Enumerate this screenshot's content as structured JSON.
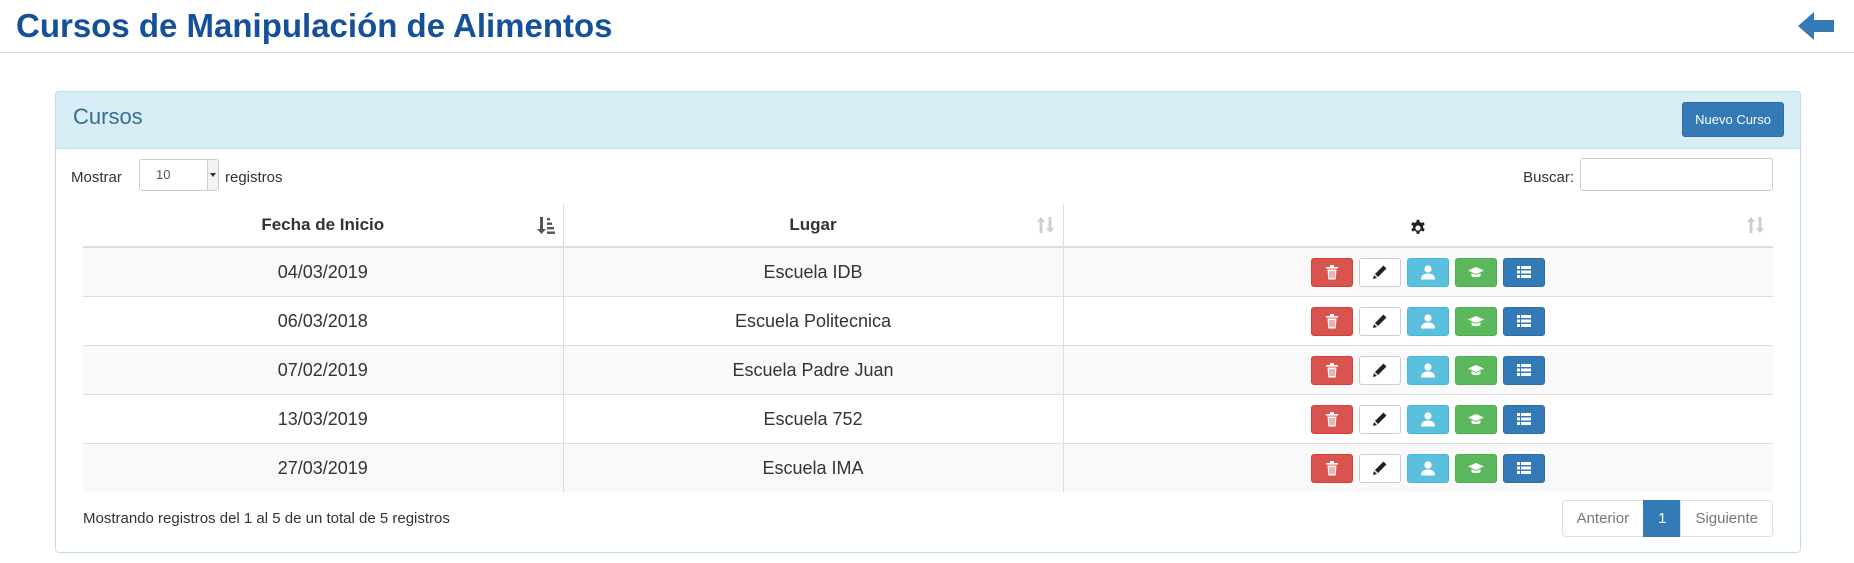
{
  "header": {
    "title": "Cursos de Manipulación de Alimentos",
    "back_icon": "arrow-left-icon",
    "accent": "#15509a"
  },
  "panel": {
    "title": "Cursos",
    "new_button": "Nuevo Curso"
  },
  "controls": {
    "show_label": "Mostrar",
    "page_size": "10",
    "records_label": "registros",
    "search_label": "Buscar:",
    "search_value": ""
  },
  "table": {
    "columns": [
      "Fecha de Inicio",
      "Lugar"
    ],
    "actions_icon": "gear-icon",
    "rows": [
      {
        "fecha": "04/03/2019",
        "lugar": "Escuela IDB"
      },
      {
        "fecha": "06/03/2018",
        "lugar": "Escuela Politecnica"
      },
      {
        "fecha": "07/02/2019",
        "lugar": "Escuela Padre Juan"
      },
      {
        "fecha": "13/03/2019",
        "lugar": "Escuela 752"
      },
      {
        "fecha": "27/03/2019",
        "lugar": "Escuela IMA"
      }
    ],
    "row_actions": [
      "trash-icon",
      "pencil-icon",
      "user-icon",
      "graduation-cap-icon",
      "list-icon"
    ]
  },
  "footer": {
    "info": "Mostrando registros del 1 al 5 de un total de 5 registros",
    "prev": "Anterior",
    "page": "1",
    "next": "Siguiente"
  },
  "colors": {
    "danger": "#d9534f",
    "info": "#5bc0de",
    "success": "#5cb85c",
    "primary": "#337ab7",
    "panel_heading": "#d9edf7"
  }
}
